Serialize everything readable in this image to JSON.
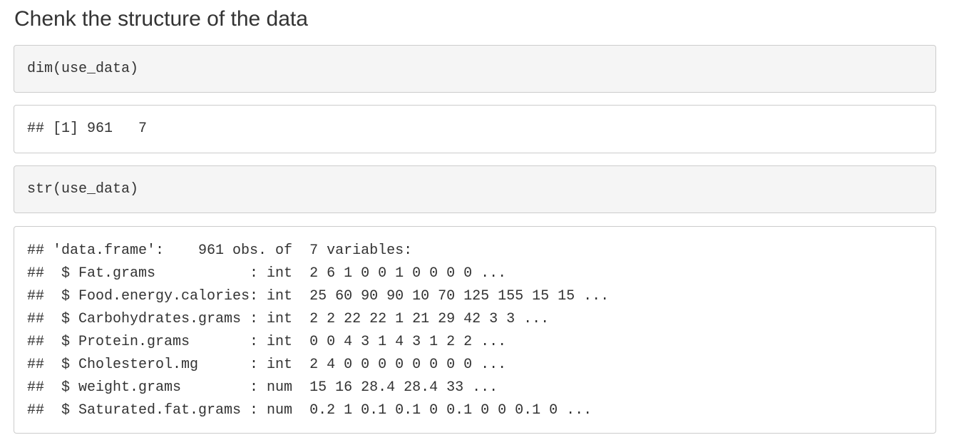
{
  "section": {
    "heading": "Chenk the structure of the data"
  },
  "cells": {
    "dim_code": "dim(use_data)",
    "dim_output": "## [1] 961   7",
    "str_code": "str(use_data)",
    "str_output": [
      "## 'data.frame':    961 obs. of  7 variables:",
      "##  $ Fat.grams           : int  2 6 1 0 0 1 0 0 0 0 ...",
      "##  $ Food.energy.calories: int  25 60 90 90 10 70 125 155 15 15 ...",
      "##  $ Carbohydrates.grams : int  2 2 22 22 1 21 29 42 3 3 ...",
      "##  $ Protein.grams       : int  0 0 4 3 1 4 3 1 2 2 ...",
      "##  $ Cholesterol.mg      : int  2 4 0 0 0 0 0 0 0 0 ...",
      "##  $ weight.grams        : num  15 16 28.4 28.4 33 ...",
      "##  $ Saturated.fat.grams : num  0.2 1 0.1 0.1 0 0.1 0 0 0.1 0 ..."
    ]
  }
}
